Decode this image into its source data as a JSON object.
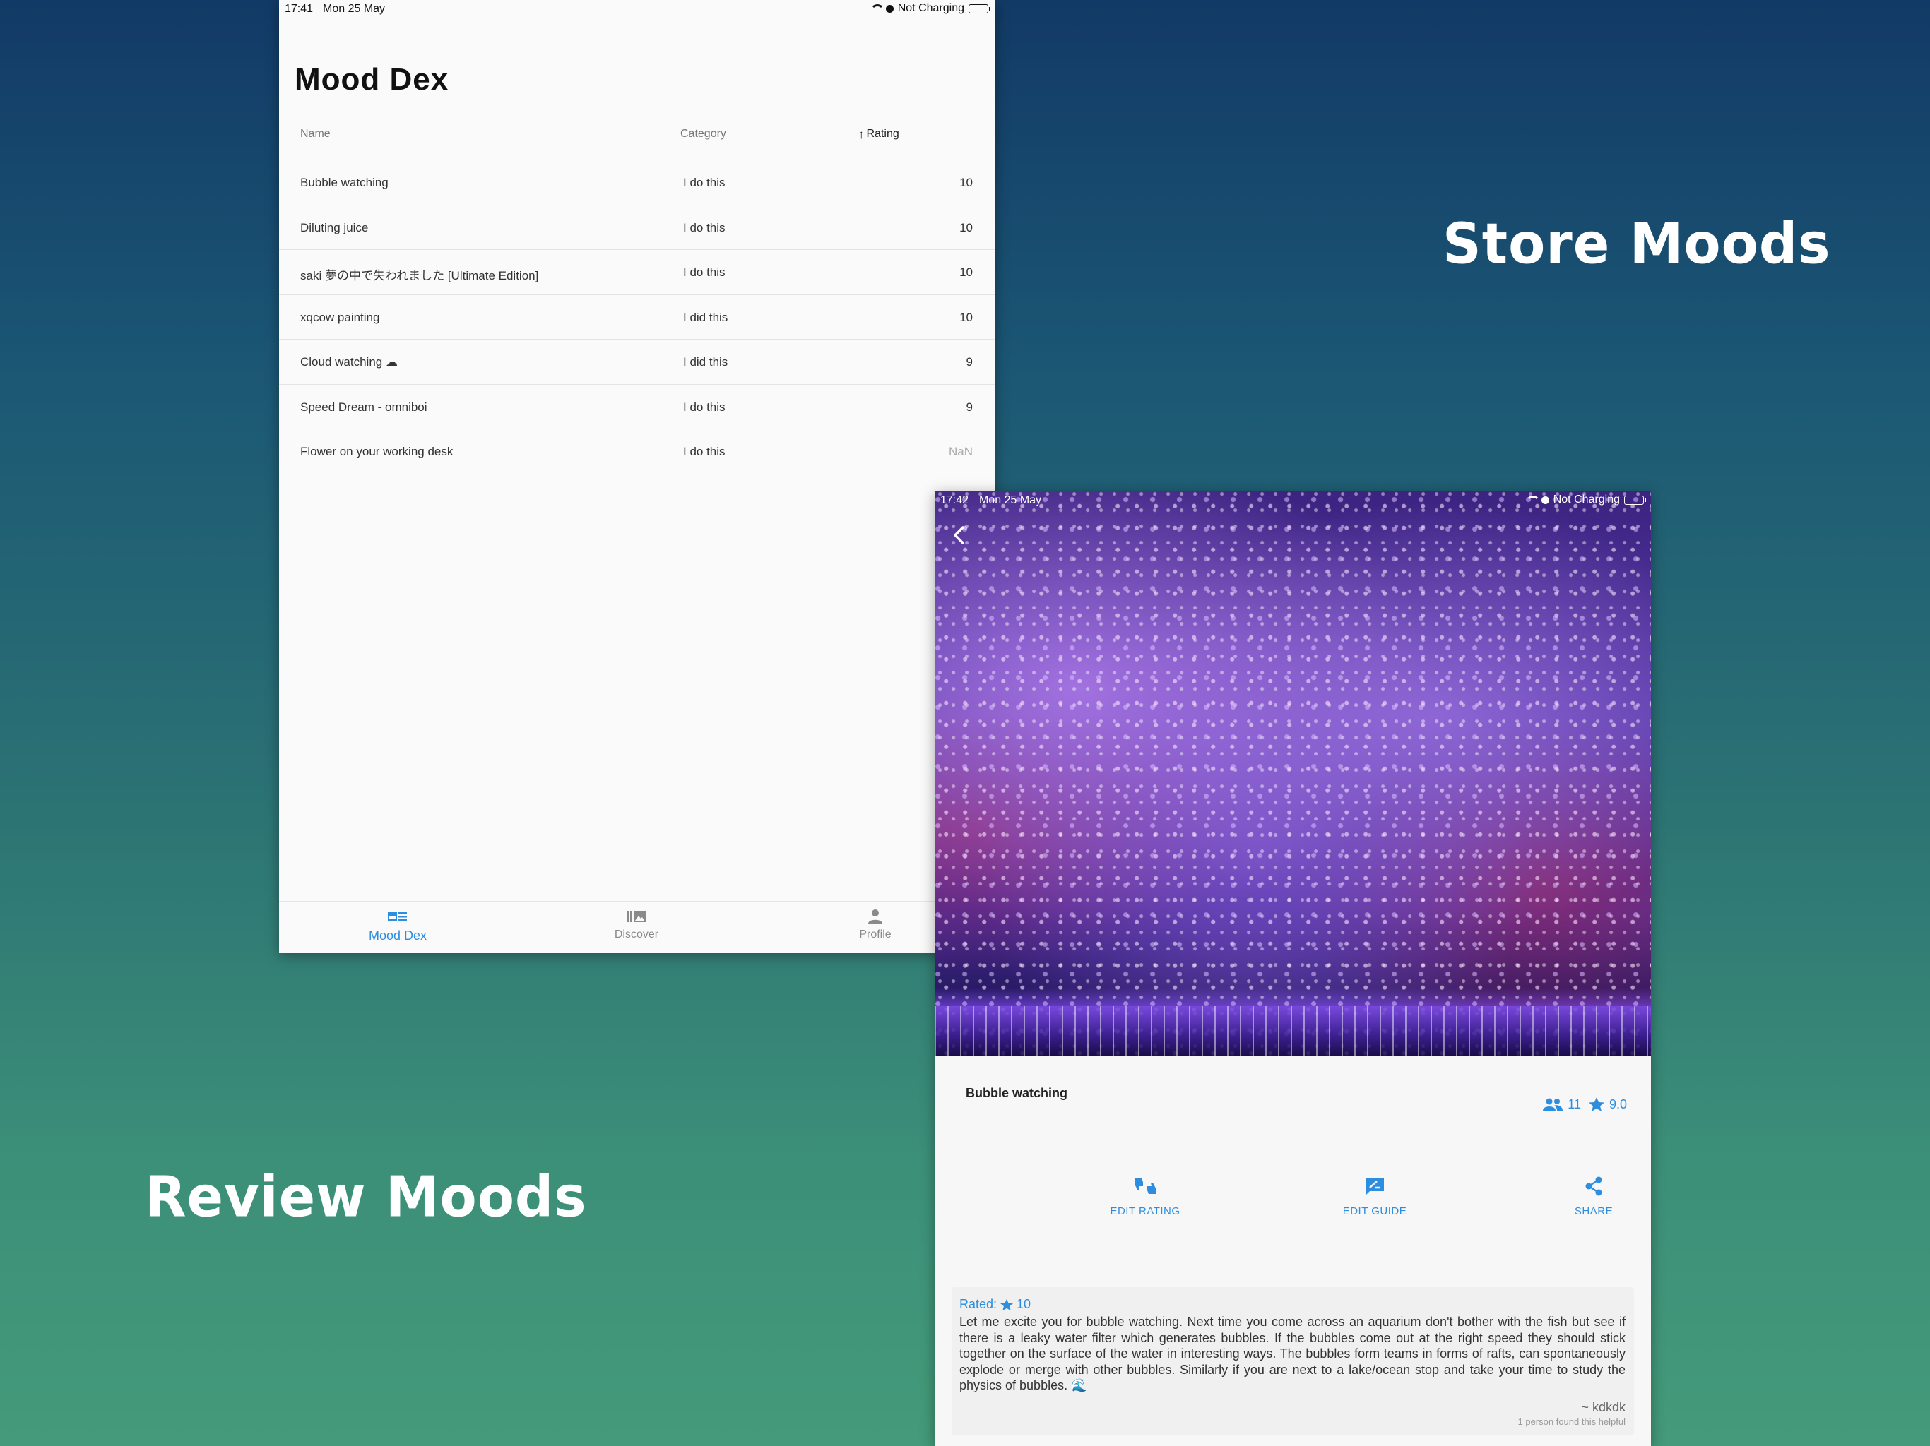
{
  "captions": {
    "store": "Store Moods",
    "review": "Review Moods"
  },
  "screen1": {
    "status": {
      "time": "17:41",
      "date": "Mon 25 May",
      "charging": "Not Charging"
    },
    "title": "Mood Dex",
    "table": {
      "headers": {
        "name": "Name",
        "category": "Category",
        "rating": "Rating"
      },
      "sort_indicator": "↑",
      "rows": [
        {
          "name": "Bubble watching",
          "category": "I do this",
          "rating": "10"
        },
        {
          "name": "Diluting juice",
          "category": "I do this",
          "rating": "10"
        },
        {
          "name": "saki 夢の中で失われました [Ultimate Edition]",
          "category": "I do this",
          "rating": "10"
        },
        {
          "name": "xqcow painting",
          "category": "I did this",
          "rating": "10"
        },
        {
          "name": "Cloud watching ☁",
          "category": "I did this",
          "rating": "9"
        },
        {
          "name": "Speed Dream - omniboi",
          "category": "I do this",
          "rating": "9"
        },
        {
          "name": "Flower on your working desk",
          "category": "I do this",
          "rating": "NaN"
        }
      ]
    },
    "nav": [
      {
        "label": "Mood Dex",
        "icon": "mood-dex-icon",
        "active": true
      },
      {
        "label": "Discover",
        "icon": "library-icon",
        "active": false
      },
      {
        "label": "Profile",
        "icon": "person-icon",
        "active": false
      }
    ]
  },
  "screen2": {
    "status": {
      "time": "17:42",
      "date": "Mon 25 May",
      "charging": "Not Charging"
    },
    "title": "Bubble watching",
    "stats": {
      "people": "11",
      "rating": "9.0"
    },
    "actions": [
      {
        "label": "EDIT RATING",
        "icon": "thumbs-icon"
      },
      {
        "label": "EDIT GUIDE",
        "icon": "rate-review-icon"
      },
      {
        "label": "SHARE",
        "icon": "share-icon"
      }
    ],
    "review": {
      "rated_label": "Rated:",
      "rated_value": "10",
      "text": "Let me excite you for bubble watching. Next time you come across an aquarium don't bother with the fish but see if there is a leaky water filter which generates bubbles. If the bubbles come out at the right speed they should stick together on the surface of the water in interesting ways. The bubbles form teams in forms of rafts, can spontaneously explode or merge with other bubbles. Similarly if you are next to a lake/ocean stop and take your time to study the physics of bubbles. 🌊",
      "author": "~ kdkdk",
      "helpful": "1 person found this helpful"
    }
  },
  "colors": {
    "accent": "#2d8ee0",
    "background_top": "#123a66",
    "background_bottom": "#449a7a"
  }
}
